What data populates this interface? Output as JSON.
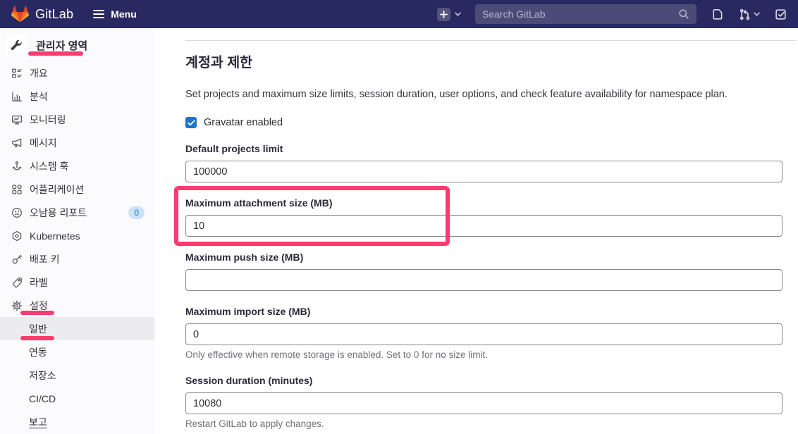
{
  "navbar": {
    "logo_text": "GitLab",
    "menu_label": "Menu",
    "search_placeholder": "Search GitLab",
    "icons": [
      "plus-icon",
      "chevron-down-icon",
      "search-icon",
      "issues-icon",
      "merge-request-icon",
      "todo-icon"
    ]
  },
  "sidebar": {
    "admin_label": "관리자 영역",
    "items": [
      {
        "label": "개요",
        "icon": "overview-icon"
      },
      {
        "label": "분석",
        "icon": "analytics-icon"
      },
      {
        "label": "모니터링",
        "icon": "monitoring-icon"
      },
      {
        "label": "메시지",
        "icon": "messages-icon"
      },
      {
        "label": "시스템 훅",
        "icon": "hook-icon"
      },
      {
        "label": "어플리케이션",
        "icon": "applications-icon"
      },
      {
        "label": "오남용 리포트",
        "icon": "abuse-report-icon",
        "badge": "0"
      },
      {
        "label": "Kubernetes",
        "icon": "kubernetes-icon"
      },
      {
        "label": "배포 키",
        "icon": "key-icon"
      },
      {
        "label": "라벨",
        "icon": "label-icon"
      },
      {
        "label": "설정",
        "icon": "gear-icon"
      }
    ],
    "subitems": [
      {
        "label": "일반",
        "active": true
      },
      {
        "label": "연동"
      },
      {
        "label": "저장소"
      },
      {
        "label": "CI/CD"
      },
      {
        "label": "보고"
      }
    ]
  },
  "content": {
    "section_title": "계정과 제한",
    "section_description": "Set projects and maximum size limits, session duration, user options, and check feature availability for namespace plan.",
    "gravatar_label": "Gravatar enabled",
    "fields": [
      {
        "label": "Default projects limit",
        "value": "100000"
      },
      {
        "label": "Maximum attachment size (MB)",
        "value": "10"
      },
      {
        "label": "Maximum push size (MB)",
        "value": ""
      },
      {
        "label": "Maximum import size (MB)",
        "value": "0",
        "help": "Only effective when remote storage is enabled. Set to 0 for no size limit."
      },
      {
        "label": "Session duration (minutes)",
        "value": "10080",
        "help": "Restart GitLab to apply changes."
      }
    ]
  },
  "colors": {
    "annotation": "#fb3b6e",
    "navbar_bg": "#292961",
    "badge_bg": "#cbe2f9",
    "badge_text": "#1f75cb",
    "checkbox_blue": "#1f75cb",
    "brand_red": "#e24329",
    "brand_orange": "#fc6d26",
    "brand_yellow": "#fca326"
  }
}
